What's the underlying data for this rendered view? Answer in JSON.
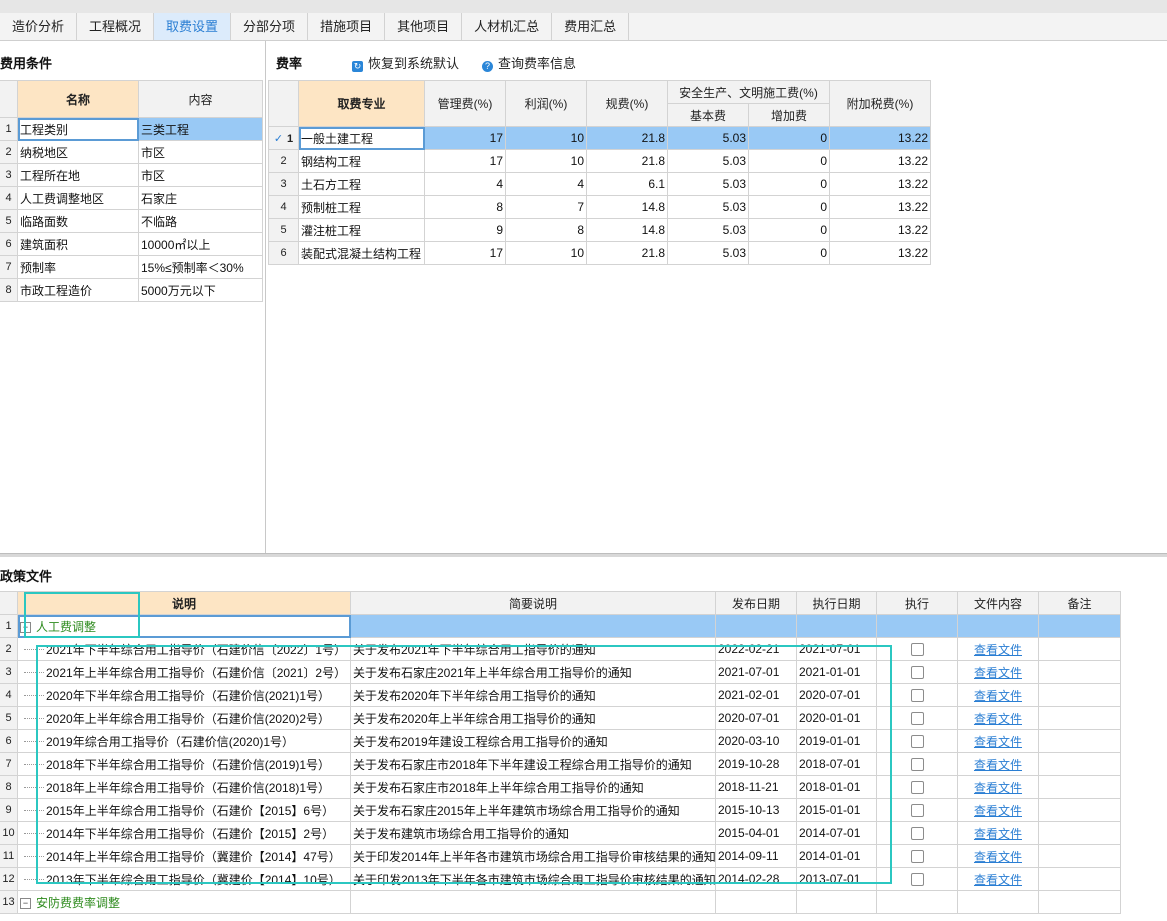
{
  "tabs": [
    {
      "label": "造价分析",
      "active": false
    },
    {
      "label": "工程概况",
      "active": false
    },
    {
      "label": "取费设置",
      "active": true
    },
    {
      "label": "分部分项",
      "active": false
    },
    {
      "label": "措施项目",
      "active": false
    },
    {
      "label": "其他项目",
      "active": false
    },
    {
      "label": "人材机汇总",
      "active": false
    },
    {
      "label": "费用汇总",
      "active": false
    }
  ],
  "conditions": {
    "title": "费用条件",
    "headers": {
      "name": "名称",
      "content": "内容"
    },
    "rows": [
      {
        "no": "1",
        "name": "工程类别",
        "content": "三类工程"
      },
      {
        "no": "2",
        "name": "纳税地区",
        "content": "市区"
      },
      {
        "no": "3",
        "name": "工程所在地",
        "content": "市区"
      },
      {
        "no": "4",
        "name": "人工费调整地区",
        "content": "石家庄"
      },
      {
        "no": "5",
        "name": "临路面数",
        "content": "不临路"
      },
      {
        "no": "6",
        "name": "建筑面积",
        "content": "10000㎡以上"
      },
      {
        "no": "7",
        "name": "预制率",
        "content": "15%≤预制率＜30%"
      },
      {
        "no": "8",
        "name": "市政工程造价",
        "content": "5000万元以下"
      }
    ]
  },
  "rates": {
    "title": "费率",
    "restore_label": "恢复到系统默认",
    "query_label": "查询费率信息",
    "headers": {
      "major": "取费专业",
      "mgmt": "管理费(%)",
      "profit": "利润(%)",
      "fee": "规费(%)",
      "safety": "安全生产、文明施工费(%)",
      "basic": "基本费",
      "extra": "增加费",
      "tax": "附加税费(%)"
    },
    "rows": [
      {
        "no": "1",
        "major": "一般土建工程",
        "mgmt": "17",
        "profit": "10",
        "fee": "21.8",
        "basic": "5.03",
        "extra": "0",
        "tax": "13.22"
      },
      {
        "no": "2",
        "major": "钢结构工程",
        "mgmt": "17",
        "profit": "10",
        "fee": "21.8",
        "basic": "5.03",
        "extra": "0",
        "tax": "13.22"
      },
      {
        "no": "3",
        "major": "土石方工程",
        "mgmt": "4",
        "profit": "4",
        "fee": "6.1",
        "basic": "5.03",
        "extra": "0",
        "tax": "13.22"
      },
      {
        "no": "4",
        "major": "预制桩工程",
        "mgmt": "8",
        "profit": "7",
        "fee": "14.8",
        "basic": "5.03",
        "extra": "0",
        "tax": "13.22"
      },
      {
        "no": "5",
        "major": "灌注桩工程",
        "mgmt": "9",
        "profit": "8",
        "fee": "14.8",
        "basic": "5.03",
        "extra": "0",
        "tax": "13.22"
      },
      {
        "no": "6",
        "major": "装配式混凝土结构工程",
        "mgmt": "17",
        "profit": "10",
        "fee": "21.8",
        "basic": "5.03",
        "extra": "0",
        "tax": "13.22"
      }
    ]
  },
  "policy": {
    "title": "政策文件",
    "headers": {
      "desc": "说明",
      "brief": "简要说明",
      "pub": "发布日期",
      "exec": "执行日期",
      "run": "执行",
      "file": "文件内容",
      "note": "备注"
    },
    "group1": {
      "no": "1",
      "label": "人工费调整"
    },
    "view_label": "查看文件",
    "rows": [
      {
        "no": "2",
        "desc": "2021年下半年综合用工指导价（石建价信〔2022〕1号）",
        "brief": "关于发布2021年下半年综合用工指导价的通知",
        "pub": "2022-02-21",
        "exec": "2021-07-01"
      },
      {
        "no": "3",
        "desc": "2021年上半年综合用工指导价（石建价信〔2021〕2号）",
        "brief": "关于发布石家庄2021年上半年综合用工指导价的通知",
        "pub": "2021-07-01",
        "exec": "2021-01-01"
      },
      {
        "no": "4",
        "desc": "2020年下半年综合用工指导价（石建价信(2021)1号）",
        "brief": "关于发布2020年下半年综合用工指导价的通知",
        "pub": "2021-02-01",
        "exec": "2020-07-01"
      },
      {
        "no": "5",
        "desc": "2020年上半年综合用工指导价（石建价信(2020)2号）",
        "brief": "关于发布2020年上半年综合用工指导价的通知",
        "pub": "2020-07-01",
        "exec": "2020-01-01"
      },
      {
        "no": "6",
        "desc": "2019年综合用工指导价（石建价信(2020)1号）",
        "brief": "关于发布2019年建设工程综合用工指导价的通知",
        "pub": "2020-03-10",
        "exec": "2019-01-01"
      },
      {
        "no": "7",
        "desc": "2018年下半年综合用工指导价（石建价信(2019)1号）",
        "brief": "关于发布石家庄市2018年下半年建设工程综合用工指导价的通知",
        "pub": "2019-10-28",
        "exec": "2018-07-01"
      },
      {
        "no": "8",
        "desc": "2018年上半年综合用工指导价（石建价信(2018)1号）",
        "brief": "关于发布石家庄市2018年上半年综合用工指导价的通知",
        "pub": "2018-11-21",
        "exec": "2018-01-01"
      },
      {
        "no": "9",
        "desc": "2015年上半年综合用工指导价（石建价【2015】6号）",
        "brief": "关于发布石家庄2015年上半年建筑市场综合用工指导价的通知",
        "pub": "2015-10-13",
        "exec": "2015-01-01"
      },
      {
        "no": "10",
        "desc": "2014年下半年综合用工指导价（石建价【2015】2号）",
        "brief": "关于发布建筑市场综合用工指导价的通知",
        "pub": "2015-04-01",
        "exec": "2014-07-01"
      },
      {
        "no": "11",
        "desc": "2014年上半年综合用工指导价（冀建价【2014】47号）",
        "brief": "关于印发2014年上半年各市建筑市场综合用工指导价审核结果的通知",
        "pub": "2014-09-11",
        "exec": "2014-01-01"
      },
      {
        "no": "12",
        "desc": "2013年下半年综合用工指导价（冀建价【2014】10号）",
        "brief": "关于印发2013年下半年各市建筑市场综合用工指导价审核结果的通知",
        "pub": "2014-02-28",
        "exec": "2013-07-01"
      }
    ],
    "group2": {
      "no": "13",
      "label": "安防费费率调整"
    }
  },
  "colors": {
    "accent": "#2a7ed3",
    "selected_row": "#99c9f5",
    "header_highlight": "#fde5c4",
    "annotation_box": "#2bc7c1"
  }
}
